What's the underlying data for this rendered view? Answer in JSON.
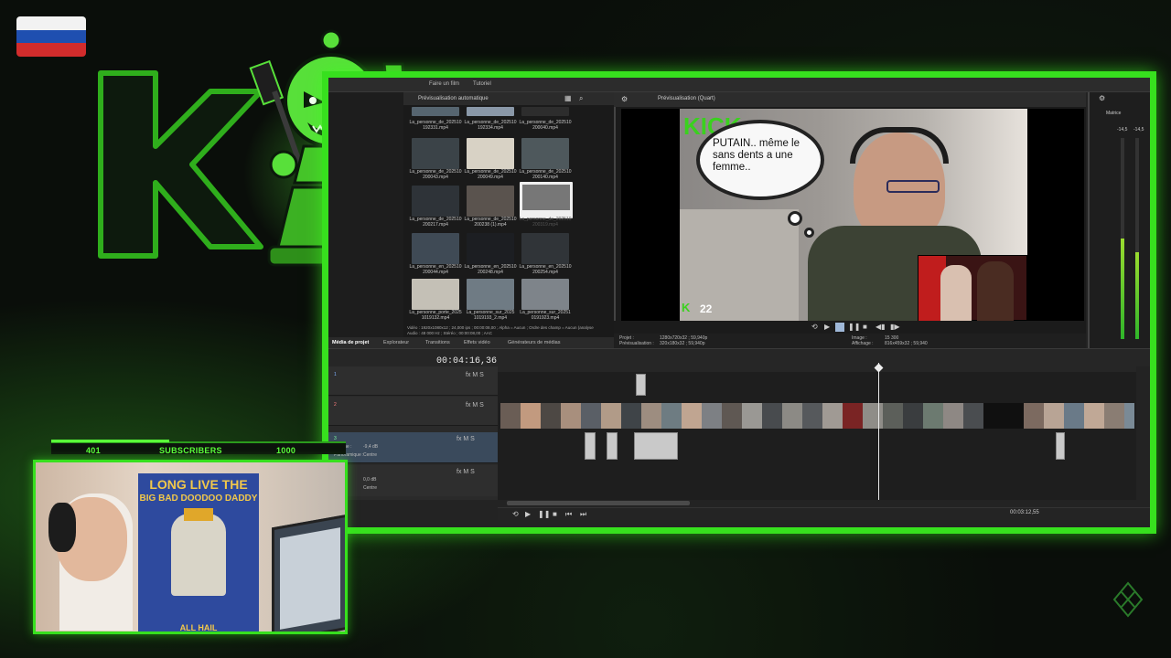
{
  "overlay": {
    "subscribers": {
      "current": "401",
      "label": "SUBSCRIBERS",
      "goal": "1000",
      "progress": 0.401
    },
    "accent_color": "#37e01e"
  },
  "editor": {
    "menu": {
      "make_movie": "Faire un film",
      "tutorial": "Tutoriel"
    },
    "media": {
      "auto_preview": "Prévisualisation automatique",
      "thumbnails": [
        {
          "name": "La_personne_de_202510 192331.mp4"
        },
        {
          "name": "La_personne_de_202510 192334.mp4"
        },
        {
          "name": "La_personne_de_202510 200040.mp4"
        },
        {
          "name": "La_personne_de_202510 200043.mp4"
        },
        {
          "name": "La_personne_de_202510 200049.mp4"
        },
        {
          "name": "La_personne_de_202510 200140.mp4"
        },
        {
          "name": "La_personne_de_202510 200217.mp4"
        },
        {
          "name": "La_personne_de_202510 200238 (1).mp4"
        },
        {
          "name": "La_personne_de_202510 200319.mp4"
        },
        {
          "name": "La_personne_en_202510 200044.mp4"
        },
        {
          "name": "La_personne_en_202510 200248.mp4"
        },
        {
          "name": "La_personne_en_202510 200254.mp4"
        },
        {
          "name": "La_personne_porte_2025 1019132.mp4"
        },
        {
          "name": "La_personne_sur_2025 1019193_2.mp4"
        },
        {
          "name": "La_personne_sur_20251 0191923.mp4"
        }
      ],
      "info_line1": "Vidéo : 1920x1080x12 ; 24,000 ips ; 00:00:08,00 ; Alpha = Aucun ; Ordre des champ = Aucun (analyse",
      "info_line2": "Audio : 48 000 Hz ; Stéréo ; 00:00:08,00 ; AAC",
      "tabs": [
        "Média de projet",
        "Explorateur",
        "Transitions",
        "Effets vidéo",
        "Générateurs de médias"
      ]
    },
    "preview": {
      "toolbar_label": "Prévisualisation (Quart)",
      "speech_bubble": "PUTAIN.. même le sans dents a une femme..",
      "channel_badge": "22",
      "project_label": "Projet :",
      "project_value": "1280x720x32 ; 59,940p",
      "preview_label": "Prévisualisation :",
      "preview_value": "320x180x32 ; 59,940p",
      "image_label": "Image :",
      "image_value": "15 300",
      "display_label": "Affichage :",
      "display_value": "816x459x32 ; 59,940"
    },
    "meter": {
      "label": "Matrice",
      "left_val": "-14,5",
      "right_val": "-14,5"
    },
    "timeline": {
      "timecode": "00:04:16,36",
      "track1": "1",
      "track2": "2",
      "track3": "3",
      "volume_label": "Volume :",
      "volume_value": "-9,4 dB",
      "pan_label": "Panoramique :",
      "pan_value": "Centre",
      "volume2_value": "0,0 dB",
      "pan2_value": "Centre",
      "end_time": "00:03:12,55"
    }
  }
}
